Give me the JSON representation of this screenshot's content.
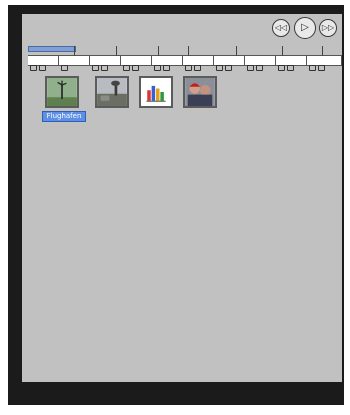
{
  "playback": {
    "rewind_icon": "rewind-icon",
    "play_icon": "play-icon",
    "forward_icon": "forward-icon",
    "rewind_glyph": "◁◁",
    "play_glyph": "▷",
    "forward_glyph": "▷▷"
  },
  "thumbnails": [
    {
      "icon": "wind-turbine-icon",
      "label": "Flughafen"
    },
    {
      "icon": "landscape-photo-icon",
      "label": ""
    },
    {
      "icon": "bar-chart-icon",
      "label": ""
    },
    {
      "icon": "people-photo-icon",
      "label": ""
    }
  ]
}
